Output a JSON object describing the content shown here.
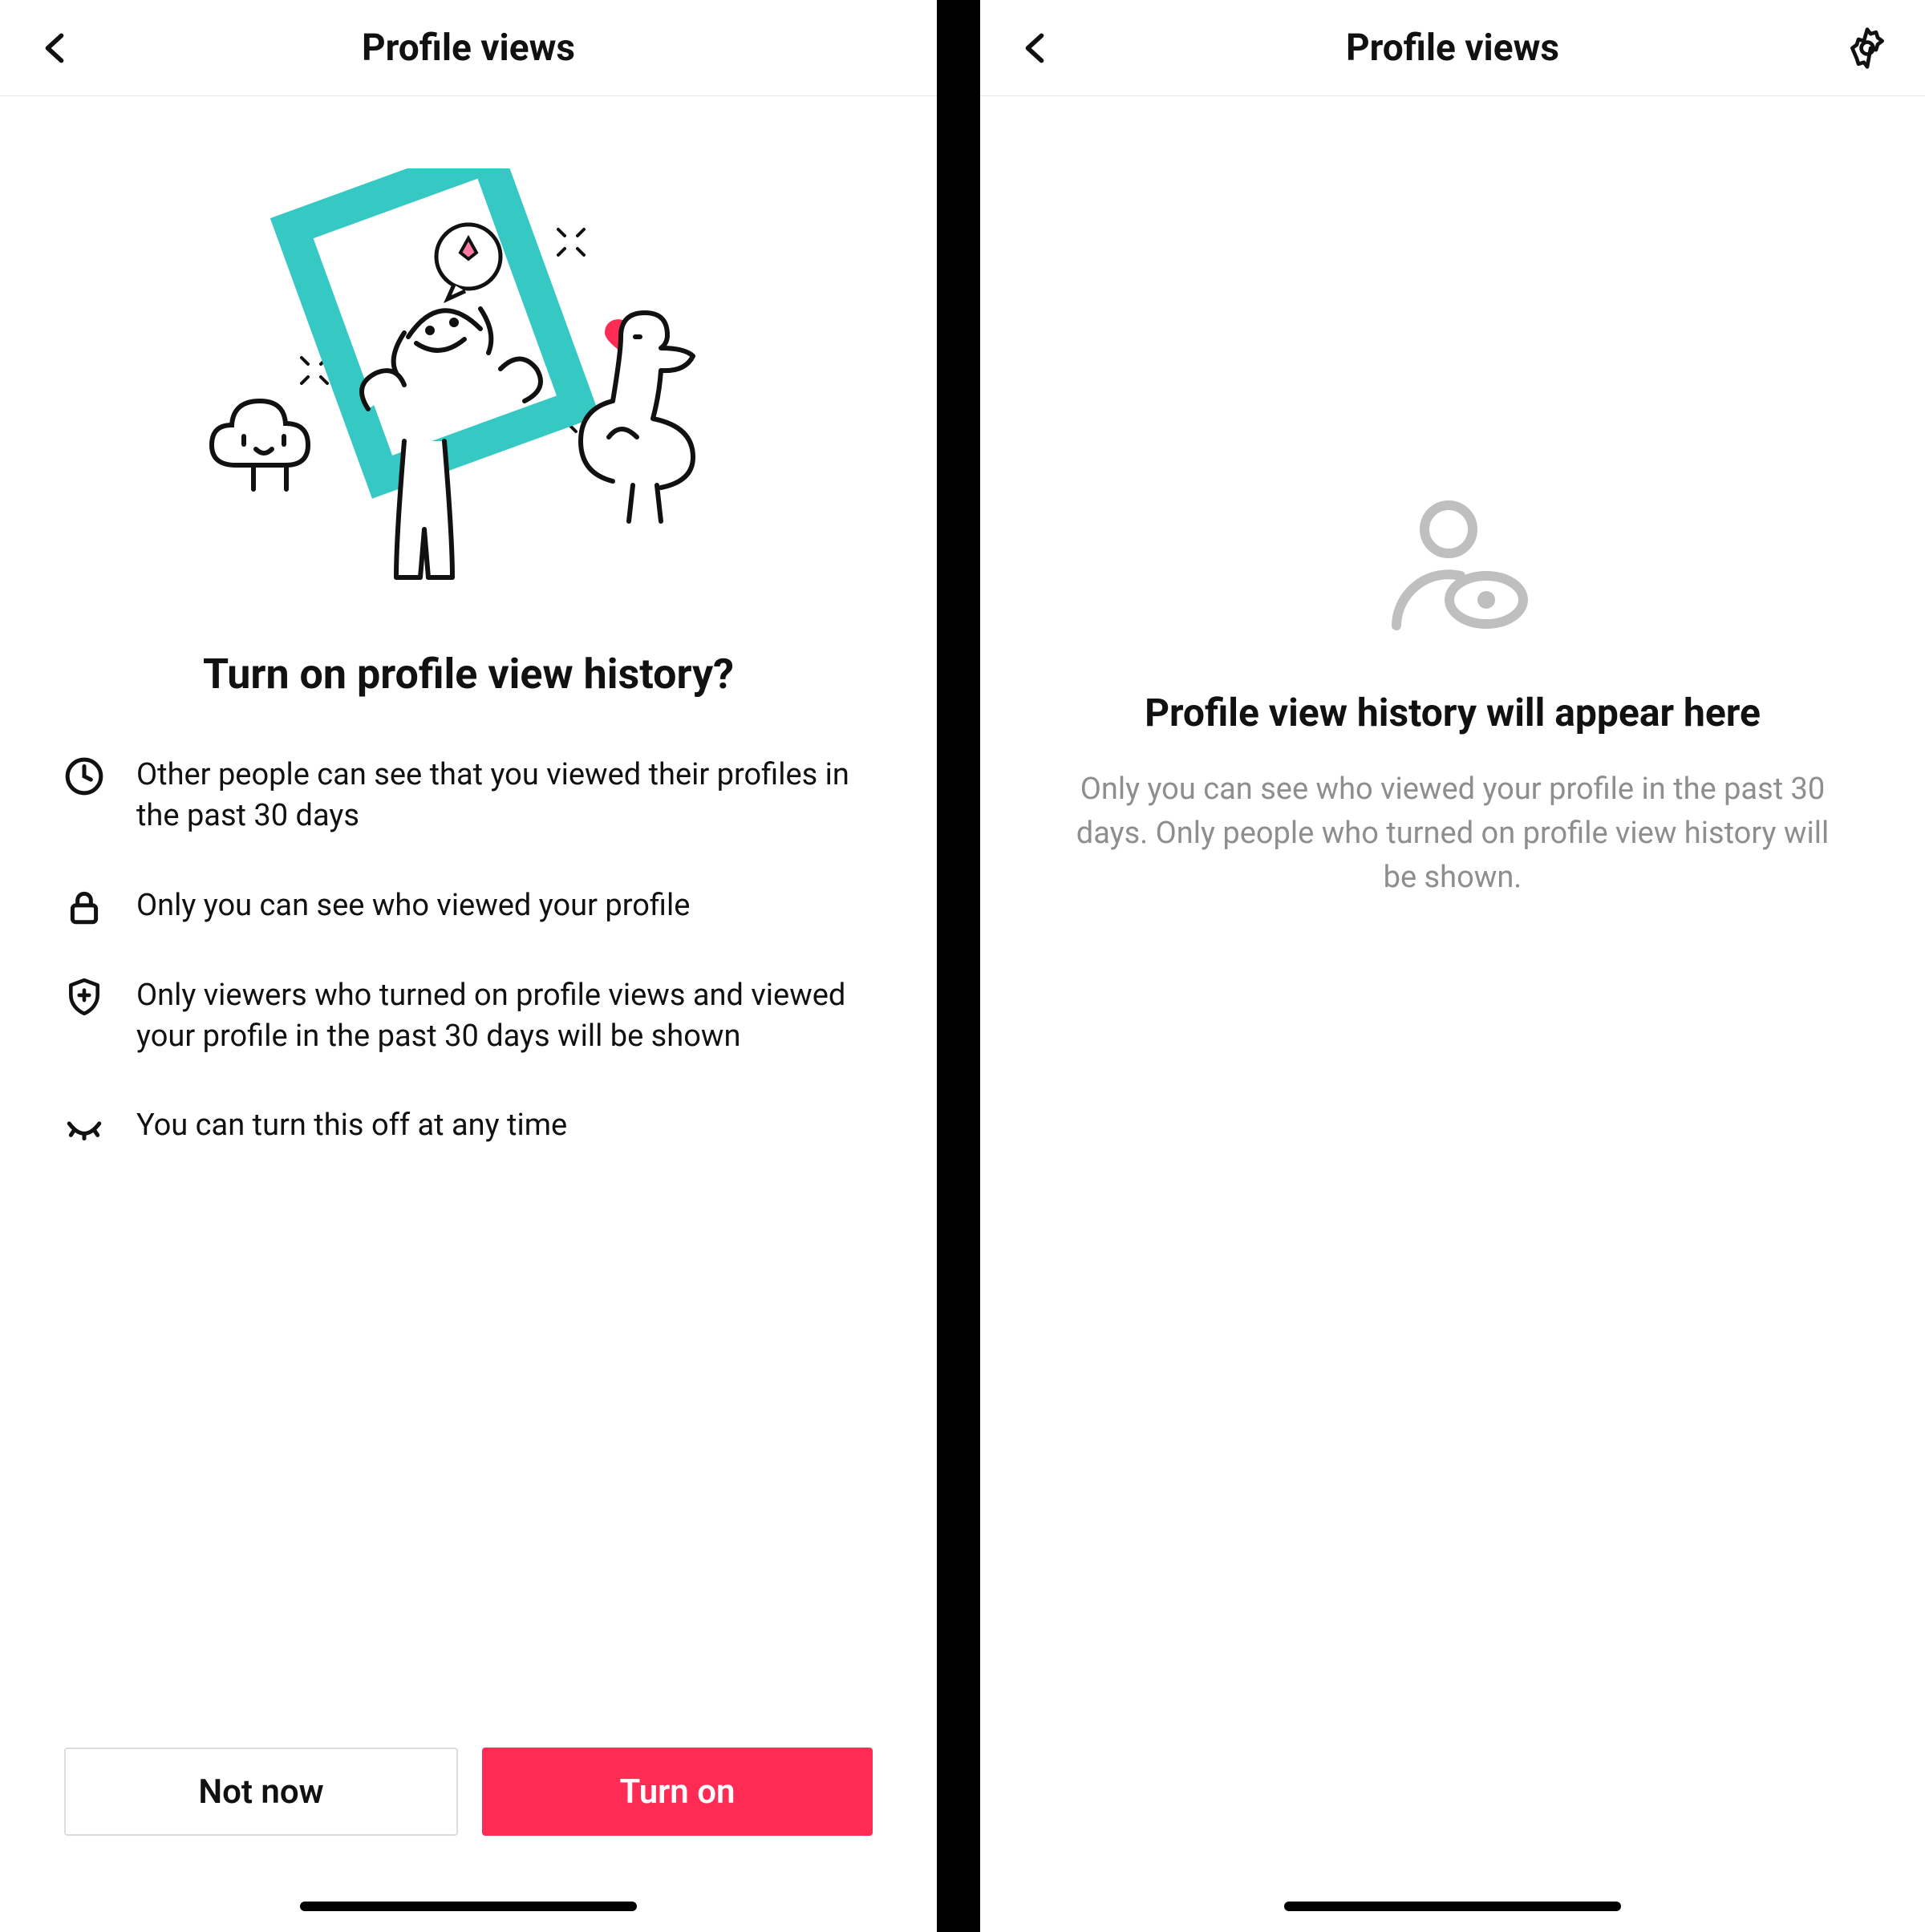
{
  "left": {
    "header": {
      "title": "Profile views"
    },
    "prompt_title": "Turn on profile view history?",
    "features": [
      {
        "icon": "clock-icon",
        "text": "Other people can see that you viewed their profiles in the past 30 days"
      },
      {
        "icon": "lock-icon",
        "text": "Only you can see who viewed your profile"
      },
      {
        "icon": "shield-plus-icon",
        "text": "Only viewers who turned on profile views and viewed your profile in the past 30 days will be shown"
      },
      {
        "icon": "closed-eye-icon",
        "text": "You can turn this off at any time"
      }
    ],
    "buttons": {
      "not_now": "Not now",
      "turn_on": "Turn on"
    },
    "colors": {
      "primary": "#fe2c55",
      "frame": "#36c9c4"
    }
  },
  "right": {
    "header": {
      "title": "Profile views"
    },
    "empty_title": "Profile view history will appear here",
    "empty_subtitle": "Only you can see who viewed your profile in the past 30 days. Only people who turned on profile view history will be shown."
  }
}
